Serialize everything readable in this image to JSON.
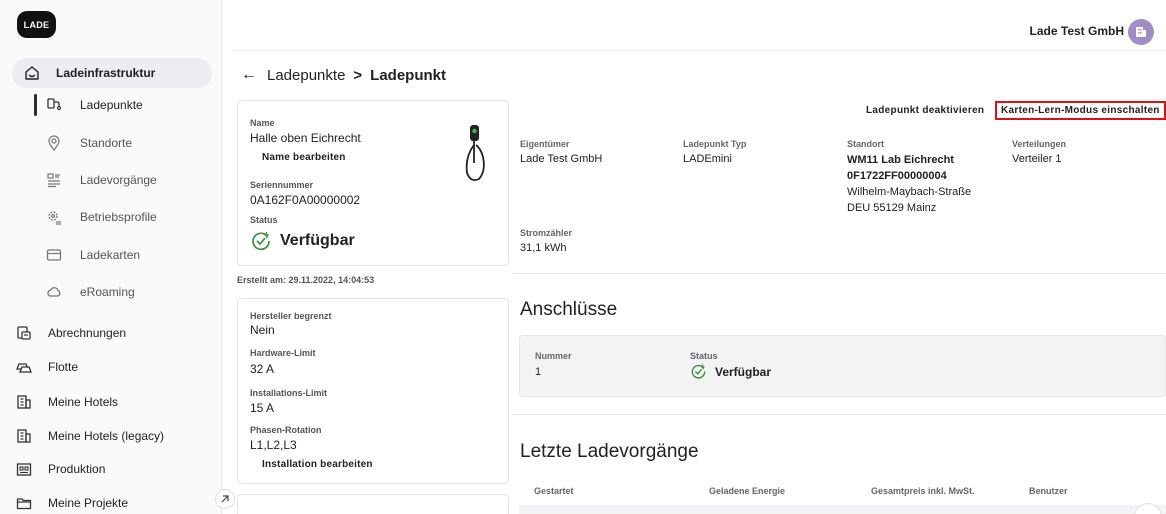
{
  "app": {
    "logo_text": "LADE",
    "company_name": "Lade Test GmbH"
  },
  "sidebar": {
    "items": [
      {
        "label": "Ladeinfrastruktur",
        "icon": "charging-infrastructure-icon"
      },
      {
        "label": "Ladepunkte",
        "icon": "charger-icon"
      },
      {
        "label": "Standorte",
        "icon": "location-pin-icon"
      },
      {
        "label": "Ladevorgänge",
        "icon": "charging-sessions-icon"
      },
      {
        "label": "Betriebsprofile",
        "icon": "settings-profile-icon"
      },
      {
        "label": "Ladekarten",
        "icon": "card-icon"
      },
      {
        "label": "eRoaming",
        "icon": "cloud-icon"
      },
      {
        "label": "Abrechnungen",
        "icon": "billing-icon"
      },
      {
        "label": "Flotte",
        "icon": "fleet-car-icon"
      },
      {
        "label": "Meine Hotels",
        "icon": "hotel-icon"
      },
      {
        "label": "Meine Hotels (legacy)",
        "icon": "hotel-icon"
      },
      {
        "label": "Produktion",
        "icon": "production-icon"
      },
      {
        "label": "Meine Projekte",
        "icon": "folder-icon"
      }
    ]
  },
  "breadcrumb": {
    "parent": "Ladepunkte",
    "separator": ">",
    "current": "Ladepunkt"
  },
  "info_card": {
    "name_label": "Name",
    "name_value": "Halle oben Eichrecht",
    "edit_name": "Name bearbeiten",
    "serial_label": "Seriennummer",
    "serial_value": "0A162F0A00000002",
    "status_label": "Status",
    "status_value": "Verfügbar",
    "created_text": "Erstellt am: 29.11.2022, 14:04:53"
  },
  "limits_card": {
    "manufacturer_limited_label": "Hersteller begrenzt",
    "manufacturer_limited_value": "Nein",
    "hardware_limit_label": "Hardware-Limit",
    "hardware_limit_value": "32 A",
    "installation_limit_label": "Installations-Limit",
    "installation_limit_value": "15 A",
    "phase_rotation_label": "Phasen-Rotation",
    "phase_rotation_value": "L1,L2,L3",
    "edit_installation": "Installation bearbeiten"
  },
  "actions": {
    "deactivate": "Ladepunkt deaktivieren",
    "card_learn_mode": "Karten-Lern-Modus einschalten"
  },
  "details": {
    "owner_label": "Eigentümer",
    "owner_value": "Lade Test GmbH",
    "type_label": "Ladepunkt Typ",
    "type_value": "LADEmini",
    "location_label": "Standort",
    "location_name": "WM11 Lab Eichrecht",
    "location_id": "0F1722FF00000004",
    "location_street": "Wilhelm-Maybach-Straße",
    "location_city": "DEU 55129 Mainz",
    "distribution_label": "Verteilungen",
    "distribution_value": "Verteiler 1",
    "meter_label": "Stromzähler",
    "meter_value": "31,1 kWh"
  },
  "connections": {
    "title": "Anschlüsse",
    "number_label": "Nummer",
    "number_value": "1",
    "status_label": "Status",
    "status_value": "Verfügbar"
  },
  "sessions": {
    "title": "Letzte Ladevorgänge",
    "columns": [
      "Gestartet",
      "Geladene Energie",
      "Gesamtpreis inkl. MwSt.",
      "Benutzer"
    ]
  },
  "colors": {
    "highlight_border": "#dd1111",
    "active_nav_bg": "#ececf1",
    "status_green": "#3a8f3a",
    "avatar": "#a08dc8"
  }
}
